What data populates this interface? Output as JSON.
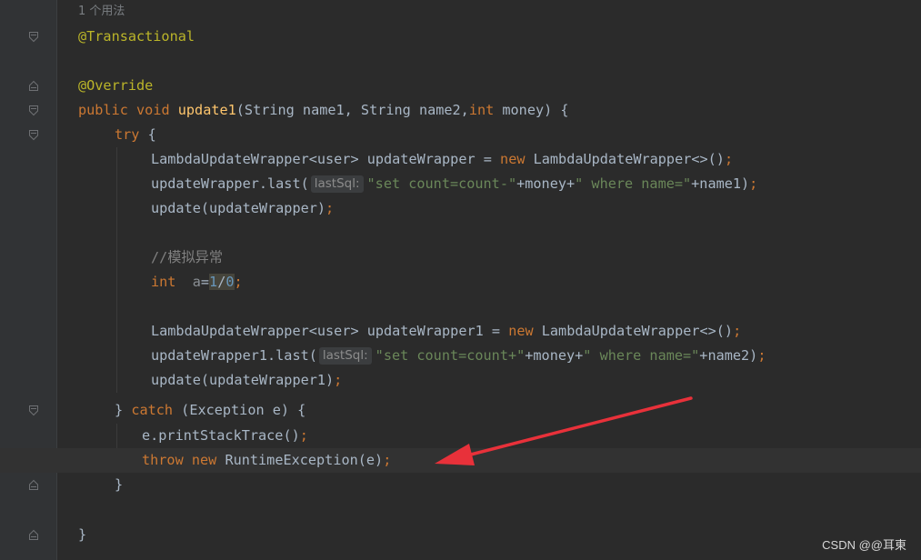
{
  "usage_hint": "1 个用法",
  "tokens": {
    "transactional": "@Transactional",
    "override": "@Override",
    "public": "public",
    "void": "void",
    "method_name": "update1",
    "params": "(String name1, String name2,",
    "int_kw": "int",
    "money_param": " money) {",
    "try": "try",
    "brace_open": " {",
    "luw": "LambdaUpdateWrapper<user> updateWrapper = ",
    "new": "new",
    "luw_ctor": " LambdaUpdateWrapper<>()",
    "semicolon": ";",
    "last_call": "updateWrapper.last(",
    "hint_label": "lastSql:",
    "sql1_a": "\"set count=count-\"",
    "plus_money": "+money+",
    "sql_where": "\" where name=\"",
    "plus_name1": "+name1)",
    "update_call": "update(updateWrapper)",
    "comment": "//模拟异常",
    "int_decl_var": "a",
    "eq": "=",
    "one": "1",
    "slash": "/",
    "zero": "0",
    "luw1": "LambdaUpdateWrapper<user> updateWrapper1 = ",
    "last_call1": "updateWrapper1.last(",
    "sql2_a": "\"set count=count+\"",
    "plus_name2": "+name2)",
    "update_call1": "update(updateWrapper1)",
    "close_brace": "}",
    "catch": "catch",
    "catch_args": " (Exception e) {",
    "print_trace": "e.printStackTrace()",
    "throw": "throw",
    "runtime_ex": " RuntimeException(e)"
  },
  "watermark": "CSDN @@耳東",
  "colors": {
    "background": "#2b2b2b",
    "keyword": "#cc7832",
    "annotation": "#bbb529",
    "function": "#ffc66d",
    "string": "#6a8759",
    "number": "#6897bb",
    "arrow": "#e8313a"
  }
}
